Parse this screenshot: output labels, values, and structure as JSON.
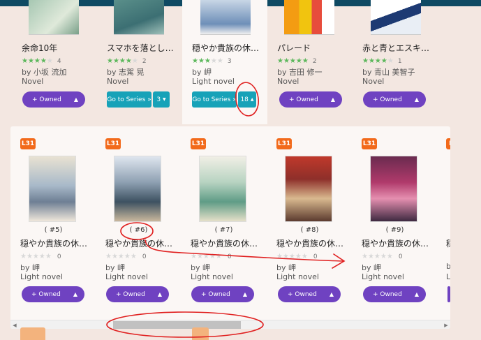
{
  "top_books": [
    {
      "title": "余命10年",
      "rating": 4,
      "count": "4",
      "author": "by 小坂 流加",
      "type": "Novel",
      "button": "+ Owned"
    },
    {
      "title": "スマホを落とし…",
      "rating": 4,
      "count": "2",
      "author": "by 志駕 晃",
      "type": "Novel",
      "series_button": "Go to Series »",
      "volume": "3"
    },
    {
      "title": "穏やか貴族の休…",
      "rating": 3,
      "count": "3",
      "author": "by 岬",
      "type": "Light novel",
      "series_button": "Go to Series »",
      "volume": "18"
    },
    {
      "title": "パレード",
      "rating": 5,
      "count": "2",
      "author": "by 吉田 修一",
      "type": "Novel",
      "button": "+ Owned"
    },
    {
      "title": "赤と青とエスキ…",
      "rating": 4,
      "count": "1",
      "author": "by 青山 美智子",
      "type": "Novel",
      "button": "+ Owned"
    }
  ],
  "volumes": [
    {
      "badge": "L31",
      "number": "( #5)",
      "title": "穏やか貴族の休…",
      "count": "0",
      "author": "by 岬",
      "type": "Light novel",
      "button": "+ Owned"
    },
    {
      "badge": "L31",
      "number": "( #6)",
      "title": "穏やか貴族の休…",
      "count": "0",
      "author": "by 岬",
      "type": "Light novel",
      "button": "+ Owned"
    },
    {
      "badge": "L31",
      "number": "( #7)",
      "title": "穏やか貴族の休…",
      "count": "0",
      "author": "by 岬",
      "type": "Light novel",
      "button": "+ Owned"
    },
    {
      "badge": "L31",
      "number": "( #8)",
      "title": "穏やか貴族の休…",
      "count": "0",
      "author": "by 岬",
      "type": "Light novel",
      "button": "+ Owned"
    },
    {
      "badge": "L31",
      "number": "( #9)",
      "title": "穏やか貴族の休…",
      "count": "0",
      "author": "by 岬",
      "type": "Light novel",
      "button": "+ Owned"
    },
    {
      "badge": "L",
      "title": "穏",
      "author": "b",
      "type": "Li"
    }
  ],
  "colors": {
    "owned_button": "#6f42c1",
    "series_button": "#17a2b8",
    "badge": "#f26a1b",
    "star_on": "#5cb85c",
    "annotation": "#e02020"
  },
  "icons": {
    "caret": "caret-up-icon",
    "star": "star-icon",
    "arrow": "scroll-arrow-icon"
  }
}
